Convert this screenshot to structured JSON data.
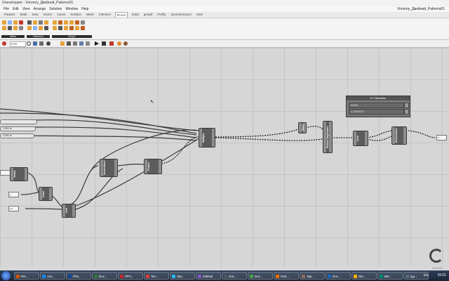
{
  "window": {
    "title": "Grasshopper - Voronoy_Двойной_Patterns01",
    "document_name": "Voronoy_Двойной_Patterns01"
  },
  "menu": [
    "File",
    "Edit",
    "View",
    "Arrange",
    "Solution",
    "Window",
    "Help"
  ],
  "tabs": [
    "Params",
    "Math",
    "Sets",
    "Vector",
    "Curve",
    "Surface",
    "Mesh",
    "Intersect",
    "XForm",
    "Kutia",
    "gHowl",
    "Firefly",
    "GeometryGym",
    "User"
  ],
  "active_tab": "XForm",
  "ribbon_panels": [
    "Affine",
    "Distortion",
    "Morph"
  ],
  "toolbar": {
    "zoom": "97%"
  },
  "sliders": [
    "1.000 m",
    "2.000 m"
  ],
  "panels": [
    "c",
    "0.1",
    "4"
  ],
  "nodes": {
    "n1": "Vector",
    "n2": "Scale",
    "n3": "Unit",
    "n4": "Deconstruct",
    "n5": "Project",
    "n6": "Multiply",
    "n7": "Move",
    "n8": "Reduce Duplicates",
    "n9": "Area",
    "n10": "Deconstruct"
  },
  "calculator": {
    "title": "IV Calculator",
    "expression": "54/60",
    "result": "1.0000007"
  },
  "status_text": "0.9.0014",
  "taskbar": {
    "items": [
      {
        "label": "Per...",
        "color": "#d35400"
      },
      {
        "label": "Aut...",
        "color": "#1e88e5"
      },
      {
        "label": "Pho...",
        "color": "#0d47a1"
      },
      {
        "label": "Doc...",
        "color": "#2e7d32"
      },
      {
        "label": "PPV...",
        "color": "#c62828"
      },
      {
        "label": "Tex...",
        "color": "#e53935"
      },
      {
        "label": "Sky...",
        "color": "#29b6f6"
      },
      {
        "label": "Mikhail",
        "color": "#7e57c2"
      },
      {
        "label": "Gra...",
        "color": "#455a64"
      },
      {
        "label": "Doc...",
        "color": "#43a047"
      },
      {
        "label": "Опе...",
        "color": "#ef6c00"
      },
      {
        "label": "Эф...",
        "color": "#8d6e63"
      },
      {
        "label": "Doc...",
        "color": "#1565c0"
      },
      {
        "label": "Ste...",
        "color": "#ffb300"
      },
      {
        "label": "Bel...",
        "color": "#00897b"
      },
      {
        "label": "tgu...",
        "color": "#546e7a"
      }
    ],
    "language": "EN",
    "clock": "15:01"
  }
}
